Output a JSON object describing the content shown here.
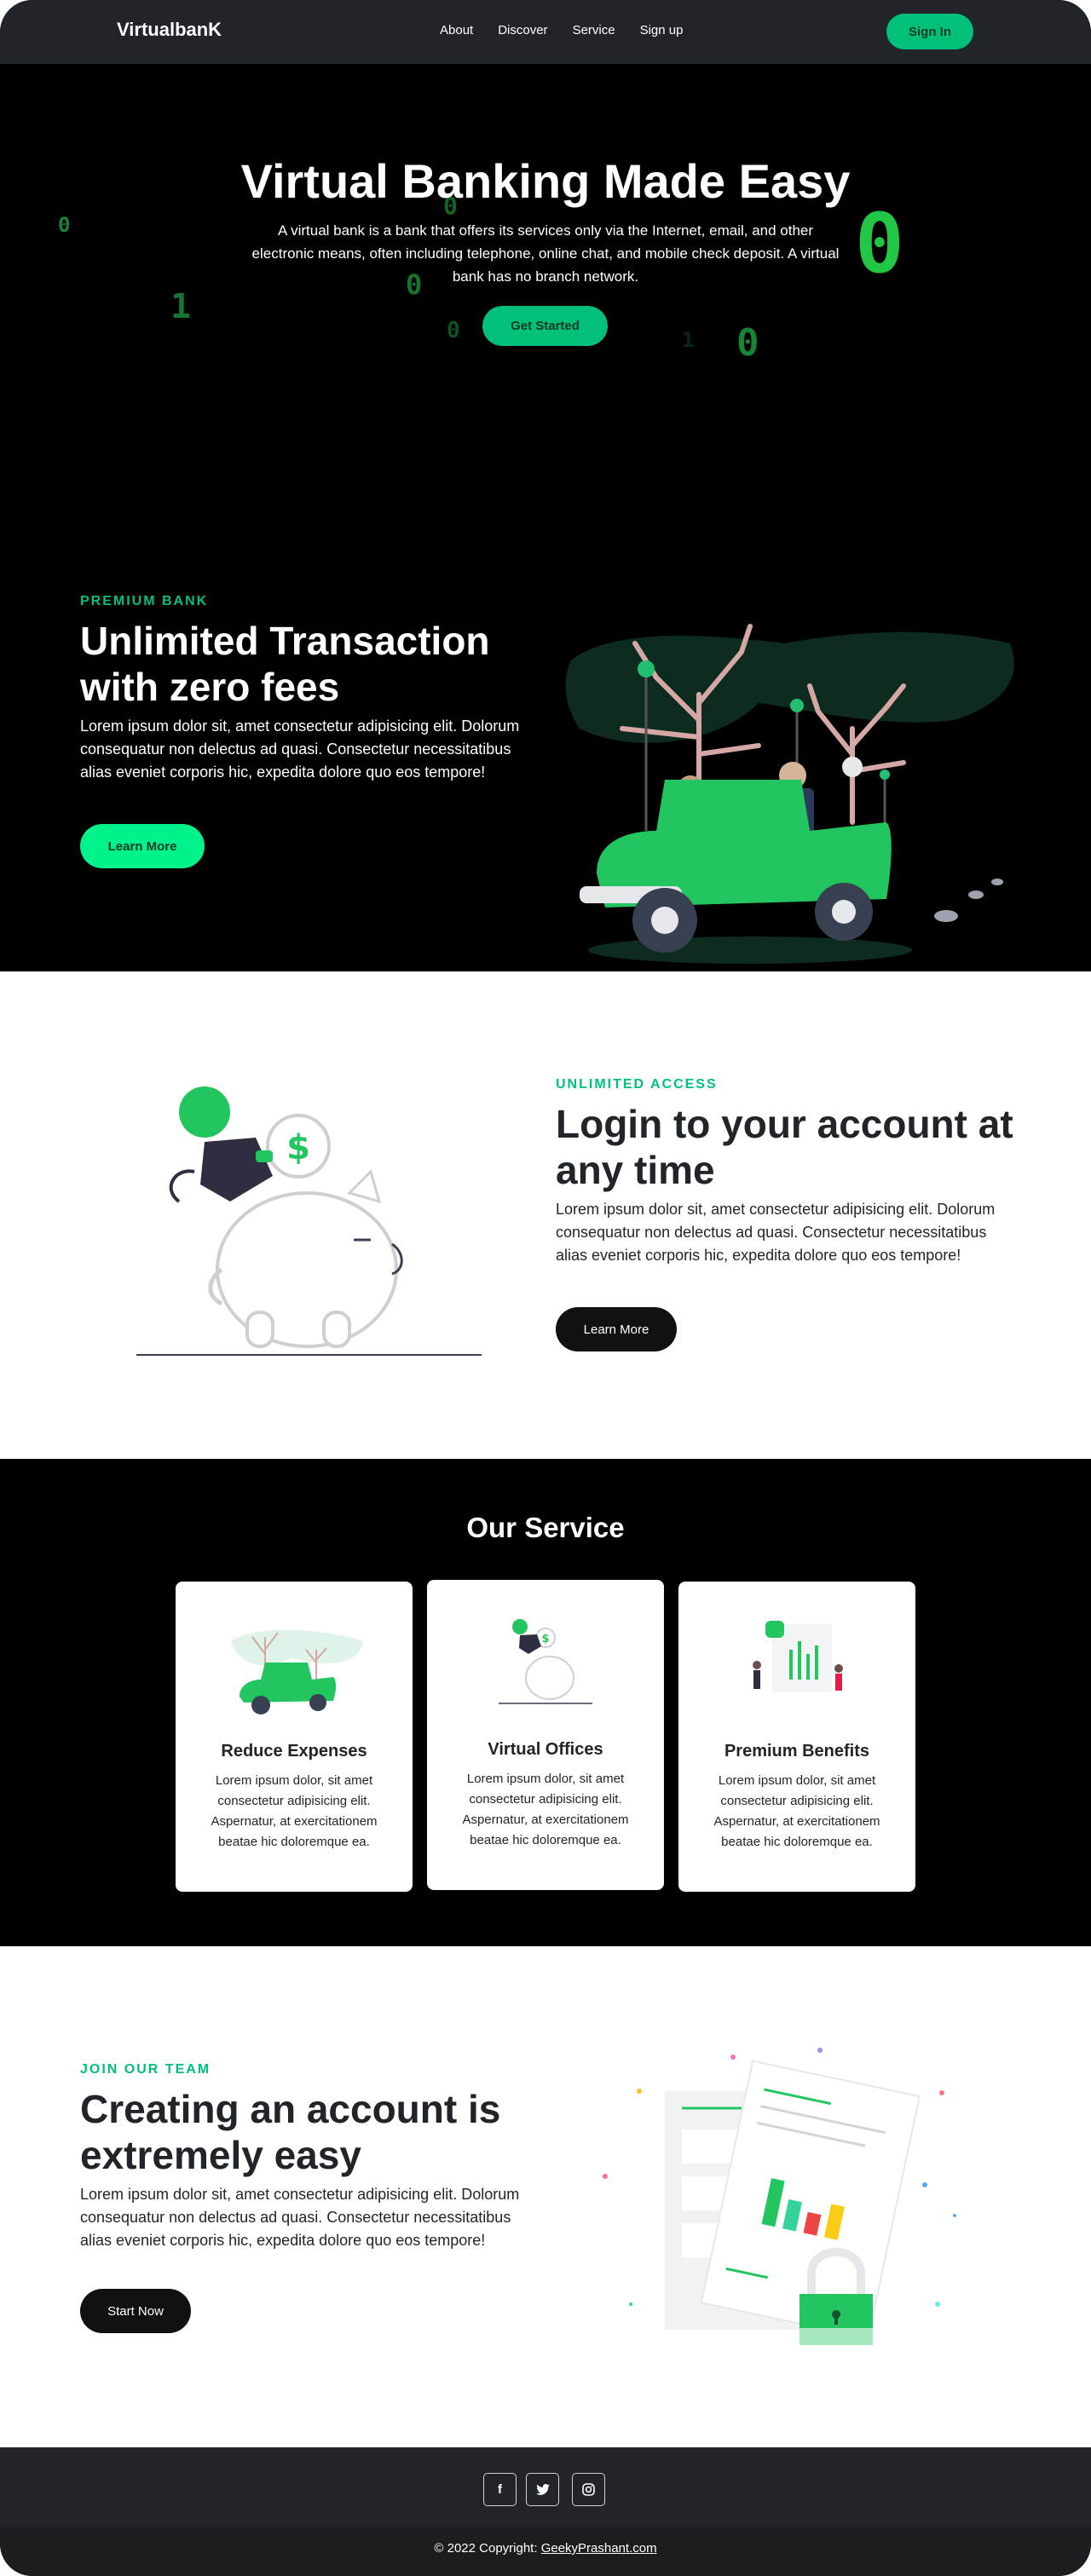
{
  "nav": {
    "brand": "VirtualbanK",
    "links": [
      "About",
      "Discover",
      "Service",
      "Sign up"
    ],
    "signin_label": "Sign In"
  },
  "hero": {
    "title": "Virtual Banking Made Easy",
    "description": "A virtual bank is a bank that offers its services only via the Internet, email, and other electronic means, often including telephone, online chat, and mobile check deposit. A virtual bank has no branch network.",
    "cta_label": "Get Started",
    "digits": [
      "0",
      "1",
      "0",
      "0",
      "0",
      "0",
      "0",
      "1"
    ]
  },
  "features": [
    {
      "eyebrow": "PREMIUM BANK",
      "title_line1": "Unlimited Transaction",
      "title_line2": "with zero fees",
      "description": "Lorem ipsum dolor sit, amet consectetur adipisicing elit. Dolorum consequatur non delectus ad quasi. Consectetur necessitatibus alias eveniet corporis hic, expedita dolore quo eos tempore!",
      "button_label": "Learn More"
    },
    {
      "eyebrow": "UNLIMITED ACCESS",
      "title_line1": "Login to your account at",
      "title_line2": "any time",
      "description": "Lorem ipsum dolor sit, amet consectetur adipisicing elit. Dolorum consequatur non delectus ad quasi. Consectetur necessitatibus alias eveniet corporis hic, expedita dolore quo eos tempore!",
      "button_label": "Learn More"
    },
    {
      "eyebrow": "JOIN OUR TEAM",
      "title_line1": "Creating an account is",
      "title_line2": "extremely easy",
      "description": "Lorem ipsum dolor sit, amet consectetur adipisicing elit. Dolorum consequatur non delectus ad quasi. Consectetur necessitatibus alias eveniet corporis hic, expedita dolore quo eos tempore!",
      "button_label": "Start Now"
    }
  ],
  "services": {
    "title": "Our Service",
    "cards": [
      {
        "title": "Reduce Expenses",
        "text": "Lorem ipsum dolor, sit amet consectetur adipisicing elit. Aspernatur, at exercitationem beatae hic doloremque ea."
      },
      {
        "title": "Virtual Offices",
        "text": "Lorem ipsum dolor, sit amet consectetur adipisicing elit. Aspernatur, at exercitationem beatae hic doloremque ea."
      },
      {
        "title": "Premium Benefits",
        "text": "Lorem ipsum dolor, sit amet consectetur adipisicing elit. Aspernatur, at exercitationem beatae hic doloremque ea."
      }
    ]
  },
  "footer": {
    "social_icons": [
      "facebook-icon",
      "twitter-icon",
      "instagram-icon"
    ],
    "social_glyphs": [
      "f",
      "🐦",
      "◎"
    ],
    "copyright_prefix": "© 2022 Copyright: ",
    "copyright_link": "GeekyPrashant.com"
  },
  "colors": {
    "accent": "#00c07a",
    "dark": "#212529",
    "black": "#000000"
  }
}
